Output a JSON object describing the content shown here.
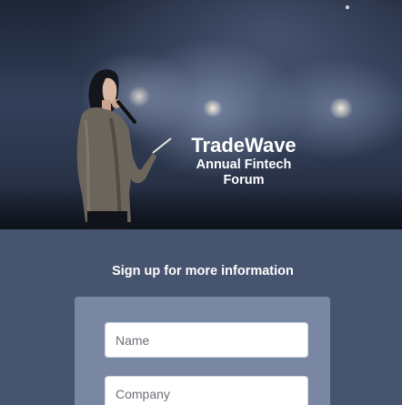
{
  "hero": {
    "brand_name": "TradeWave",
    "event_line1": "Annual Fintech",
    "event_line2": "Forum"
  },
  "signup": {
    "heading": "Sign up for more information",
    "fields": {
      "name": {
        "placeholder": "Name",
        "value": ""
      },
      "company": {
        "placeholder": "Company",
        "value": ""
      }
    }
  },
  "colors": {
    "page_background": "#46546f",
    "form_card": "#7a87a3",
    "text": "#ffffff"
  }
}
